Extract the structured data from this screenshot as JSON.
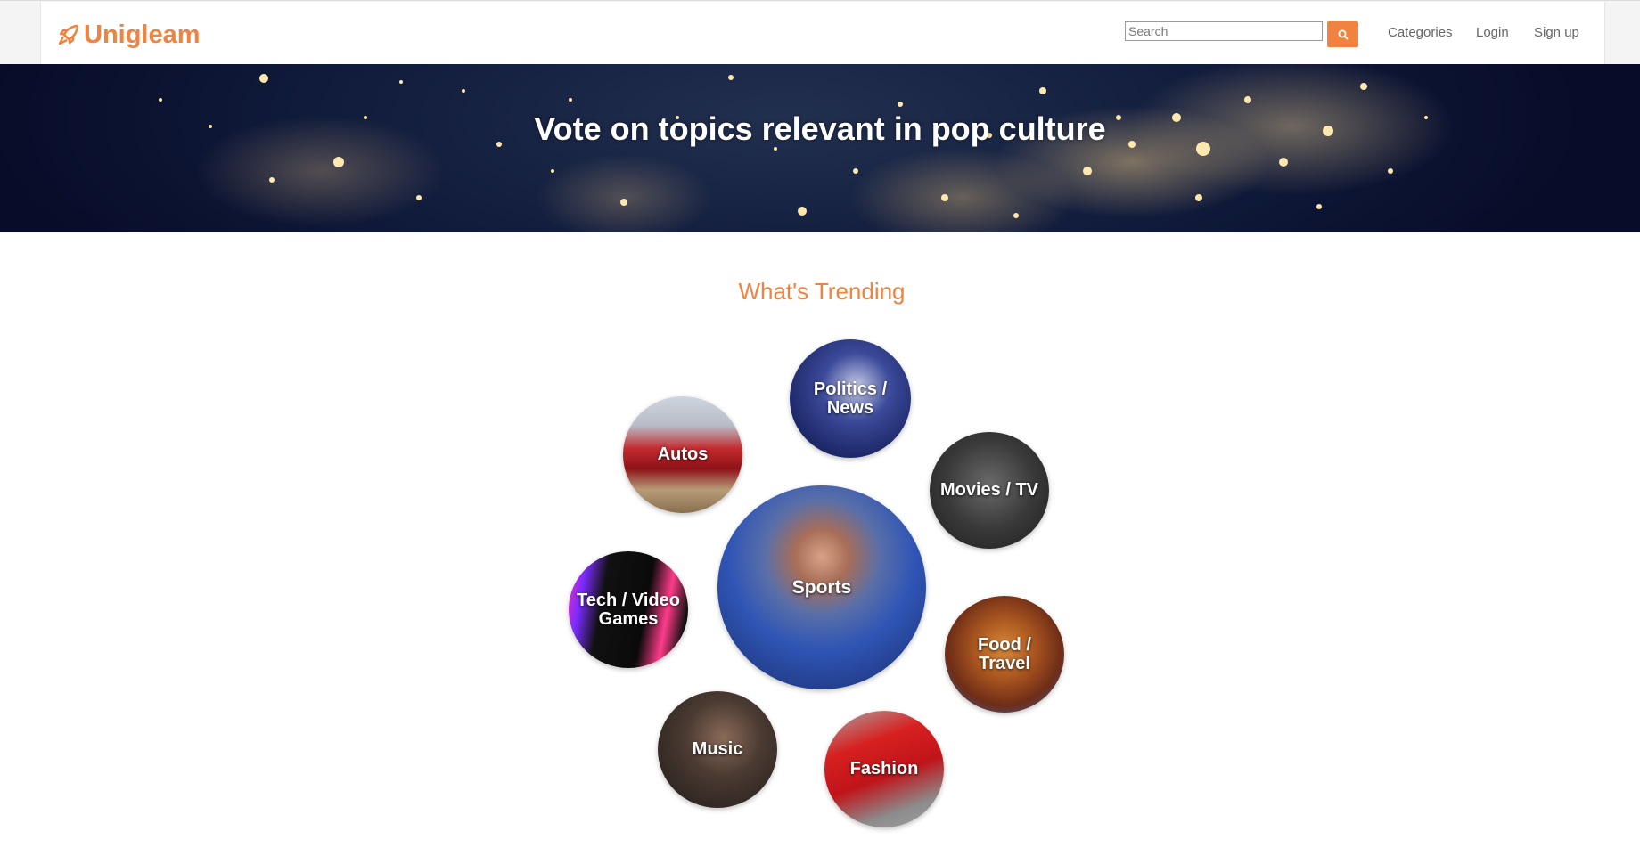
{
  "header": {
    "brand": "Unigleam",
    "search": {
      "placeholder": "Search",
      "value": ""
    },
    "nav": [
      {
        "label": "Categories"
      },
      {
        "label": "Login"
      },
      {
        "label": "Sign up"
      }
    ]
  },
  "hero": {
    "title": "Vote on topics relevant in pop culture"
  },
  "trending": {
    "title": "What's Trending",
    "categories": [
      {
        "label": "Politics / News"
      },
      {
        "label": "Autos"
      },
      {
        "label": "Movies / TV"
      },
      {
        "label": "Sports"
      },
      {
        "label": "Tech / Video Games"
      },
      {
        "label": "Food / Travel"
      },
      {
        "label": "Music"
      },
      {
        "label": "Fashion"
      }
    ]
  },
  "colors": {
    "accent": "#f0833f",
    "hero_bg": "#0b1434"
  },
  "icons": {
    "logo": "rocket-icon",
    "search": "search-icon"
  }
}
